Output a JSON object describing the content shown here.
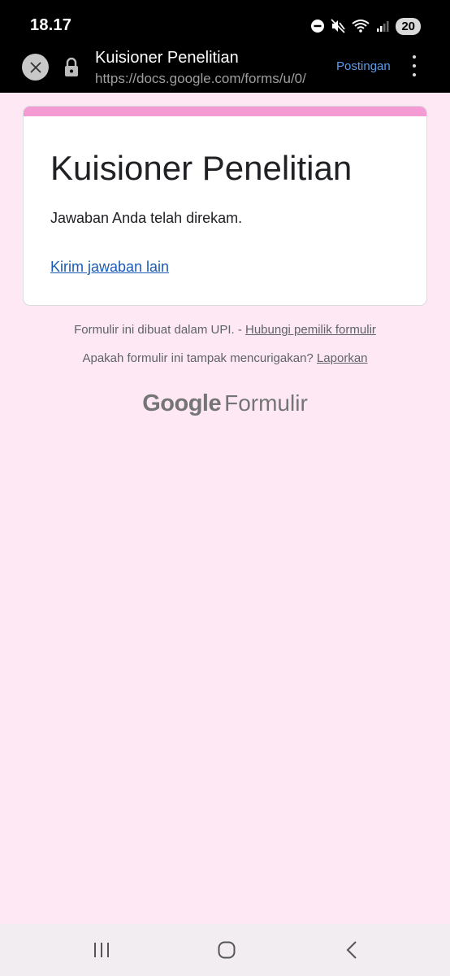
{
  "status_bar": {
    "time": "18.17",
    "battery": "20",
    "icons": [
      "do-not-disturb-icon",
      "mute-icon",
      "wifi-icon",
      "signal-icon",
      "battery-icon"
    ]
  },
  "app_bar": {
    "title": "Kuisioner Penelitian",
    "url": "https://docs.google.com/forms/u/0/",
    "post_label": "Postingan",
    "icons": [
      "close-icon",
      "lock-icon",
      "more-vert-icon"
    ]
  },
  "card": {
    "title": "Kuisioner Penelitian",
    "message": "Jawaban Anda telah direkam.",
    "link": "Kirim jawaban lain",
    "accent_color": "#f59bd3"
  },
  "footer": {
    "line1_text": "Formulir ini dibuat dalam UPI. - ",
    "line1_link": "Hubungi pemilik formulir",
    "line2_text": "Apakah formulir ini tampak mencurigakan? ",
    "line2_link": "Laporkan",
    "brand_google": "Google",
    "brand_product": "Formulir"
  },
  "nav_bar": {
    "icons": [
      "recent-apps-icon",
      "home-icon",
      "back-icon"
    ]
  },
  "colors": {
    "background": "#fde8f4",
    "link": "#1a5bb8",
    "post_button": "#5a9cf0"
  }
}
